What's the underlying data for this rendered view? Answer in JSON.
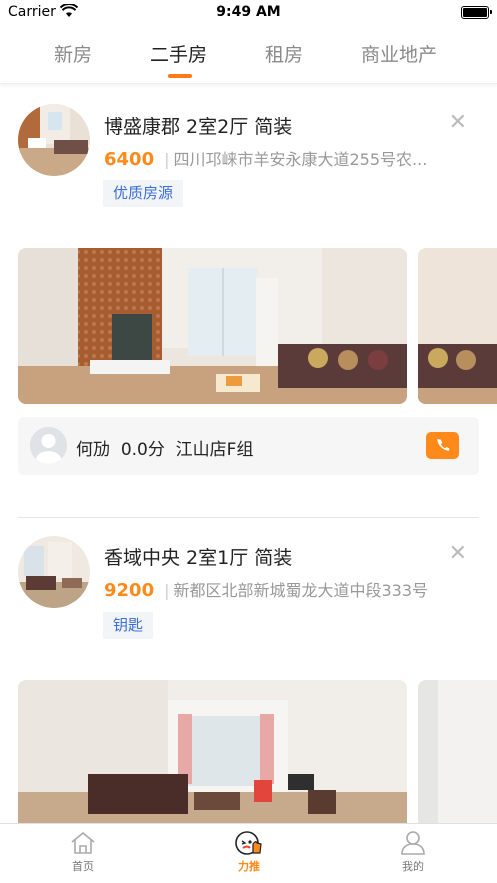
{
  "status_bar": {
    "carrier": "Carrier",
    "time": "9:49 AM"
  },
  "tabs": [
    {
      "label": "新房"
    },
    {
      "label": "二手房"
    },
    {
      "label": "租房"
    },
    {
      "label": "商业地产"
    }
  ],
  "active_tab": "二手房",
  "listings": [
    {
      "title": "博盛康郡 2室2厅 简装",
      "price": "6400",
      "address": "四川邛崃市羊安永康大道255号农...",
      "tag": "优质房源",
      "agent": {
        "name": "何劢",
        "score": "0.0分",
        "store": "江山店F组"
      }
    },
    {
      "title": "香域中央 2室1厅 简装",
      "price": "9200",
      "address": "新都区北部新城蜀龙大道中段333号",
      "tag": "钥匙"
    }
  ],
  "bottom_nav": [
    {
      "label": "首页",
      "icon": "home-icon"
    },
    {
      "label": "力推",
      "icon": "recommend-icon"
    },
    {
      "label": "我的",
      "icon": "profile-icon"
    }
  ],
  "colors": {
    "accent": "#ff8a1a",
    "tag_text": "#3a6fd8",
    "indicator": "#ff7a1a"
  }
}
